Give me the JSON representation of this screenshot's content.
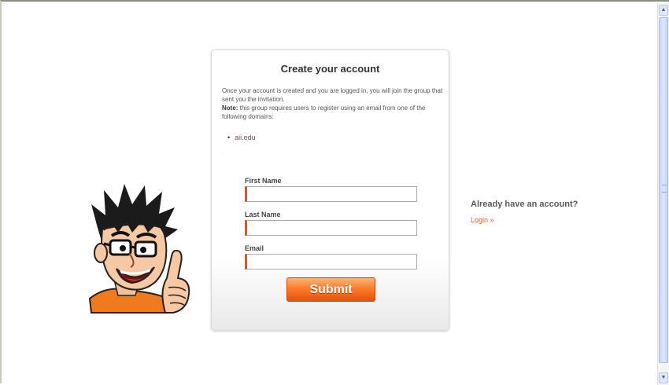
{
  "form": {
    "title": "Create your account",
    "intro_text": "Once your account is created and you are logged in, you will join the group that sent you the invitation.",
    "note_label": "Note:",
    "note_text": " this group requires users to register using an email from one of the following domains:",
    "domains": [
      "aii.edu"
    ],
    "fields": [
      {
        "label": "First Name",
        "value": ""
      },
      {
        "label": "Last Name",
        "value": ""
      },
      {
        "label": "Email",
        "value": ""
      }
    ],
    "submit_label": "Submit"
  },
  "login": {
    "prompt": "Already have an account?",
    "link_label": "Login »"
  },
  "icons": {
    "mascot": "cartoon-mascot-thumbs-up",
    "scroll_up": "up-arrow-icon",
    "scroll_down": "down-arrow-icon"
  },
  "colors": {
    "accent": "#e8501c",
    "submit_top": "#ffb37d",
    "submit_bottom": "#e4520d",
    "link": "#e85a2a",
    "scrollbar": "#c8d6f7"
  }
}
